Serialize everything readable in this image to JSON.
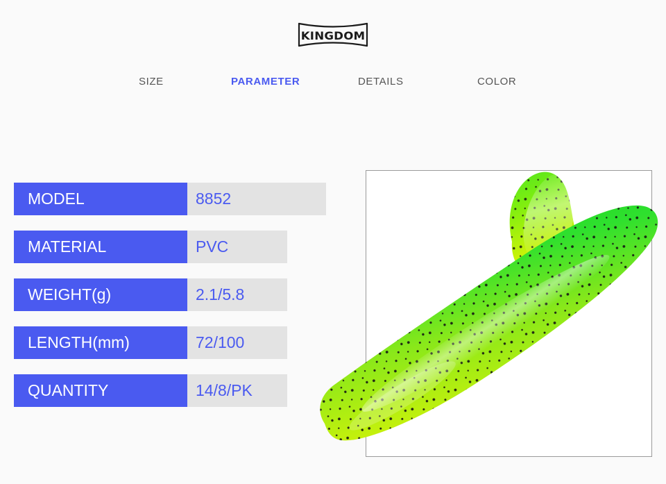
{
  "brand": {
    "logo_text": "KINGDOM",
    "logo_icon": "bowtie-arcs-icon"
  },
  "nav": {
    "items": [
      {
        "label": "SIZE",
        "active": false
      },
      {
        "label": "PARAMETER",
        "active": true
      },
      {
        "label": "DETAILS",
        "active": false
      },
      {
        "label": "COLOR",
        "active": false
      }
    ]
  },
  "spec_table": {
    "rows": [
      {
        "label": "MODEL",
        "unit": "",
        "value": "8852"
      },
      {
        "label": "MATERIAL",
        "unit": "",
        "value": "PVC"
      },
      {
        "label": "WEIGHT",
        "unit": " (g)",
        "value": "2.1/5.8"
      },
      {
        "label": "LENGTH",
        "unit": " (mm)",
        "value": "72/100"
      },
      {
        "label": "QUANTITY",
        "unit": "",
        "value": "14/8/PK"
      }
    ]
  },
  "product_image": {
    "alt": "soft-plastic-paddle-tail-fishing-lure",
    "colors": {
      "accent_blue": "#4a5af0",
      "value_cell": "#e3e3e3",
      "page_background": "#fafafa",
      "panel_border": "#9a9a9a",
      "lure_green": "#22d922",
      "lure_yellow": "#d8ef07",
      "lure_speck": "#111111"
    }
  }
}
